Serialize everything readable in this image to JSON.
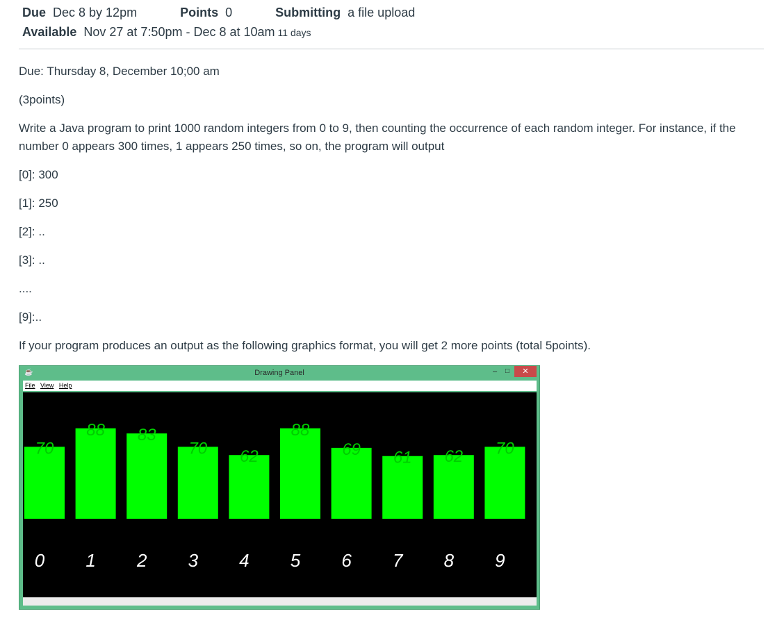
{
  "header": {
    "due_label": "Due",
    "due_value": "Dec 8 by 12pm",
    "points_label": "Points",
    "points_value": "0",
    "submitting_label": "Submitting",
    "submitting_value": "a file upload",
    "available_label": "Available",
    "available_value": "Nov 27 at 7:50pm - Dec 8 at 10am",
    "available_duration": "11 days"
  },
  "body": {
    "due_line": "Due: Thursday 8, December 10;00 am",
    "points_line": "(3points)",
    "instructions": "Write a Java program to print 1000 random integers from 0 to 9, then counting the occurrence of each random integer. For instance, if the number 0 appears 300 times, 1 appears 250 times, so on, the program will output",
    "output_lines": [
      "[0]: 300",
      "[1]: 250",
      "[2]: ..",
      "[3]: ..",
      "....",
      "[9]:.."
    ],
    "bonus_line": "If your program produces an output as the following graphics format, you will get 2 more points (total 5points)."
  },
  "window": {
    "title": "Drawing Panel",
    "menu": [
      "File",
      "View",
      "Help"
    ],
    "minimize": "–",
    "maximize": "□",
    "close": "✕"
  },
  "chart_data": {
    "type": "bar",
    "categories": [
      "0",
      "1",
      "2",
      "3",
      "4",
      "5",
      "6",
      "7",
      "8",
      "9"
    ],
    "values": [
      70,
      88,
      83,
      70,
      62,
      88,
      69,
      61,
      62,
      70
    ],
    "bar_color": "#00ff00",
    "value_label_color": "#00cc00",
    "category_label_color": "#ffffff",
    "background": "#000000"
  }
}
